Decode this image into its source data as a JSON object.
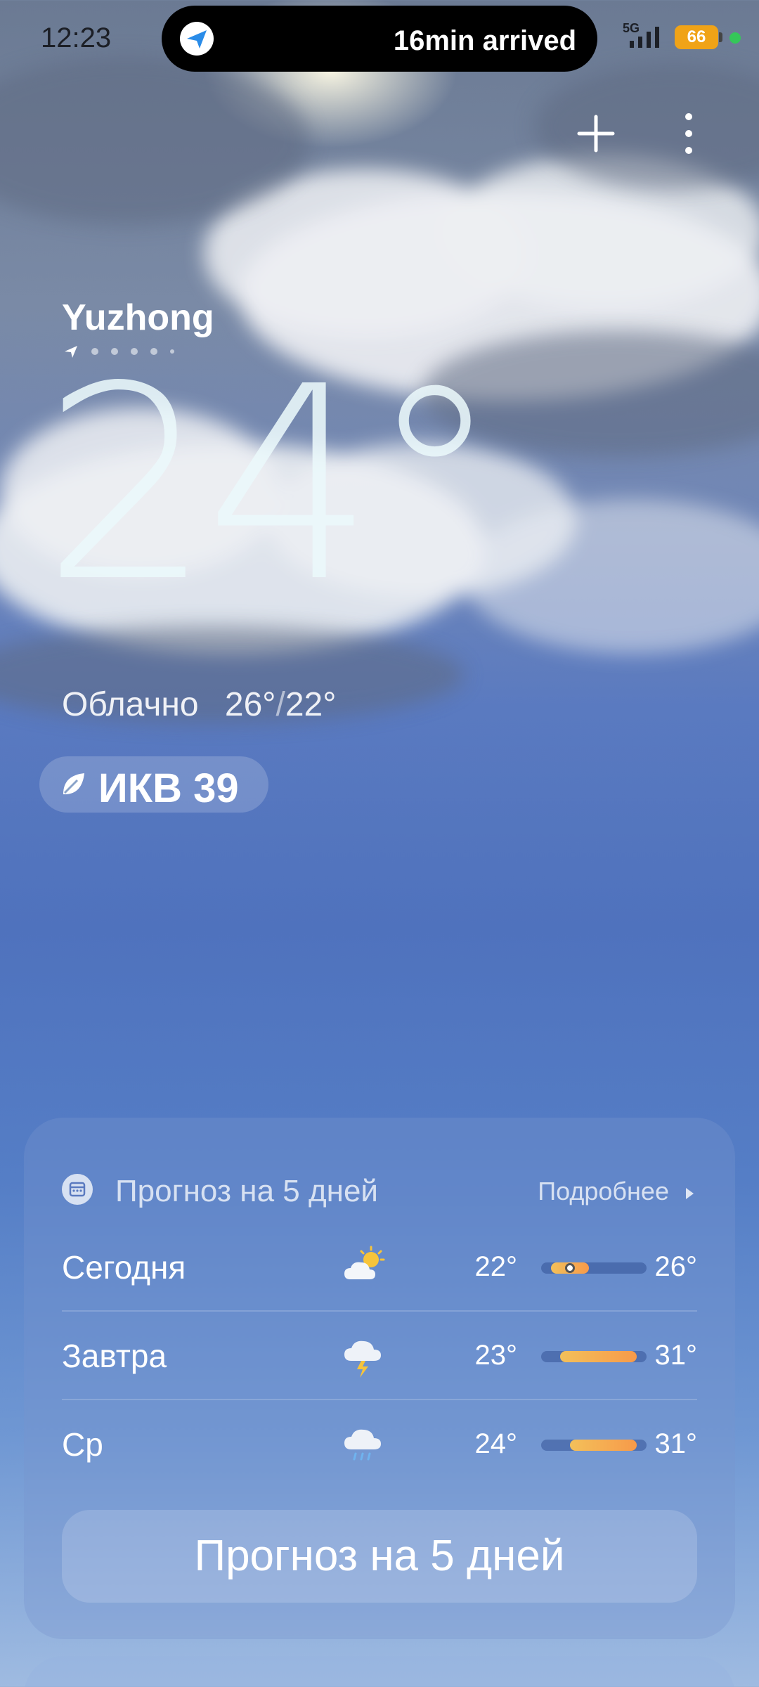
{
  "status": {
    "time": "12:23",
    "island_text": "16min arrived",
    "network": "5G",
    "battery": "66"
  },
  "location": {
    "city": "Yuzhong",
    "page_count": 6,
    "current_page": 0
  },
  "current": {
    "temperature": "24°",
    "condition": "Облачно",
    "high": "26°",
    "low": "22°",
    "aqi": "ИКВ 39"
  },
  "forecast": {
    "title": "Прогноз на 5 дней",
    "more": "Подробнее",
    "button": "Прогноз на 5 дней",
    "days": [
      {
        "day": "Сегодня",
        "icon": "partly-cloudy-icon",
        "low": "22°",
        "high": "26°",
        "low_value": 22,
        "high_value": 26,
        "current_value": 24
      },
      {
        "day": "Завтра",
        "icon": "thunderstorm-icon",
        "low": "23°",
        "high": "31°",
        "low_value": 23,
        "high_value": 31
      },
      {
        "day": "Ср",
        "icon": "rain-icon",
        "low": "24°",
        "high": "31°",
        "low_value": 24,
        "high_value": 31
      }
    ],
    "scale_min": 21,
    "scale_max": 32
  },
  "colors": {
    "bar_start": "#f3c05a",
    "bar_end": "#f79a4a",
    "battery": "#f0a317",
    "active_dot": "#35c759"
  }
}
